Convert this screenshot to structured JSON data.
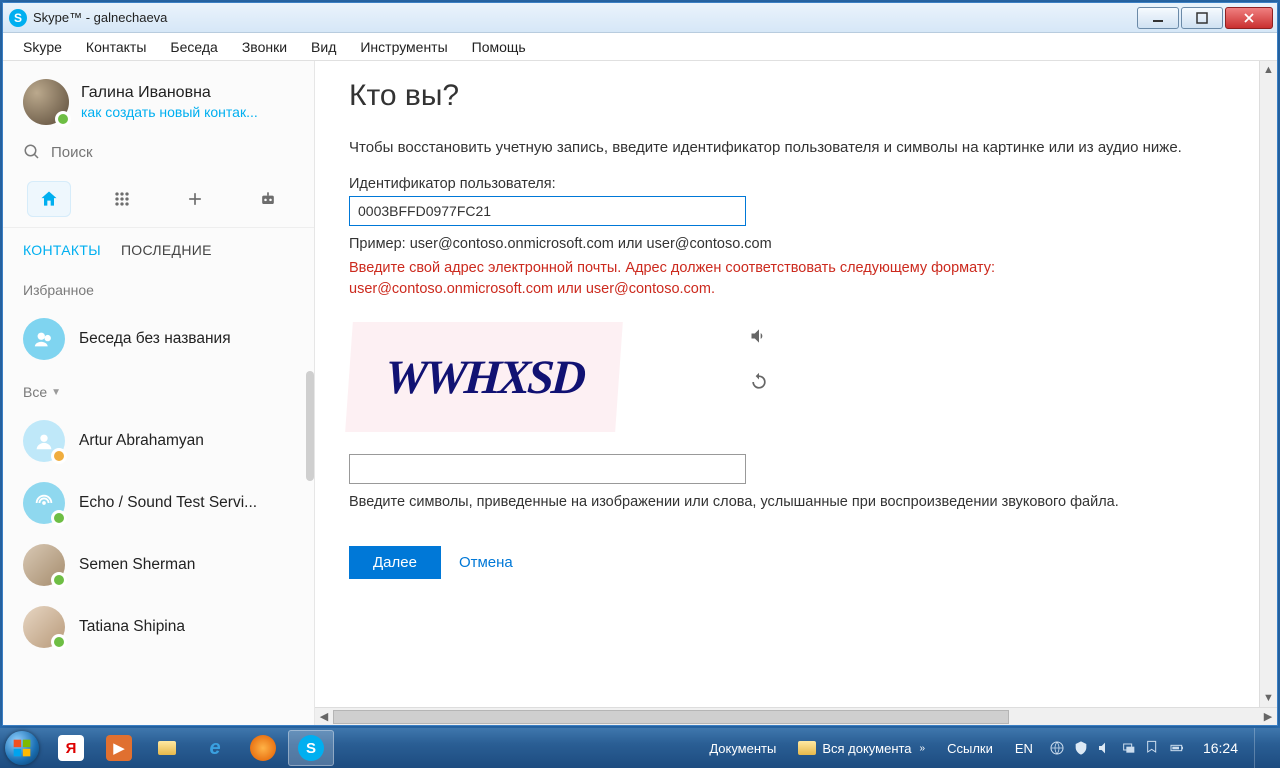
{
  "window": {
    "title": "Skype™ - galnechaeva"
  },
  "menubar": [
    "Skype",
    "Контакты",
    "Беседа",
    "Звонки",
    "Вид",
    "Инструменты",
    "Помощь"
  ],
  "profile": {
    "name": "Галина Ивановна",
    "mood": "как создать новый контак..."
  },
  "search": {
    "placeholder": "Поиск"
  },
  "tabs": {
    "contacts": "КОНТАКТЫ",
    "recent": "ПОСЛЕДНИЕ"
  },
  "sections": {
    "favorites": "Избранное",
    "all": "Все"
  },
  "contacts": {
    "fav1": "Беседа без названия",
    "c1": "Artur Abrahamyan",
    "c2": "Echo / Sound Test Servi...",
    "c3": "Semen Sherman",
    "c4": "Tatiana Shipina"
  },
  "main": {
    "heading": "Кто вы?",
    "intro": "Чтобы восстановить учетную запись, введите идентификатор пользователя и символы на картинке или из аудио ниже.",
    "userid_label": "Идентификатор пользователя:",
    "userid_value": "0003BFFD0977FC21",
    "example": "Пример: user@contoso.onmicrosoft.com или user@contoso.com",
    "error": "Введите свой адрес электронной почты. Адрес должен соответствовать следующему формату: user@contoso.onmicrosoft.com или user@contoso.com.",
    "captcha_text": "WWHXSD",
    "captcha_hint": "Введите символы, приведенные на изображении или слова, услышанные при воспроизведении звукового файла.",
    "next": "Далее",
    "cancel": "Отмена"
  },
  "taskbar": {
    "documents": "Документы",
    "all_docs": "Вся документа",
    "links": "Ссылки",
    "lang": "EN",
    "time": "16:24"
  }
}
